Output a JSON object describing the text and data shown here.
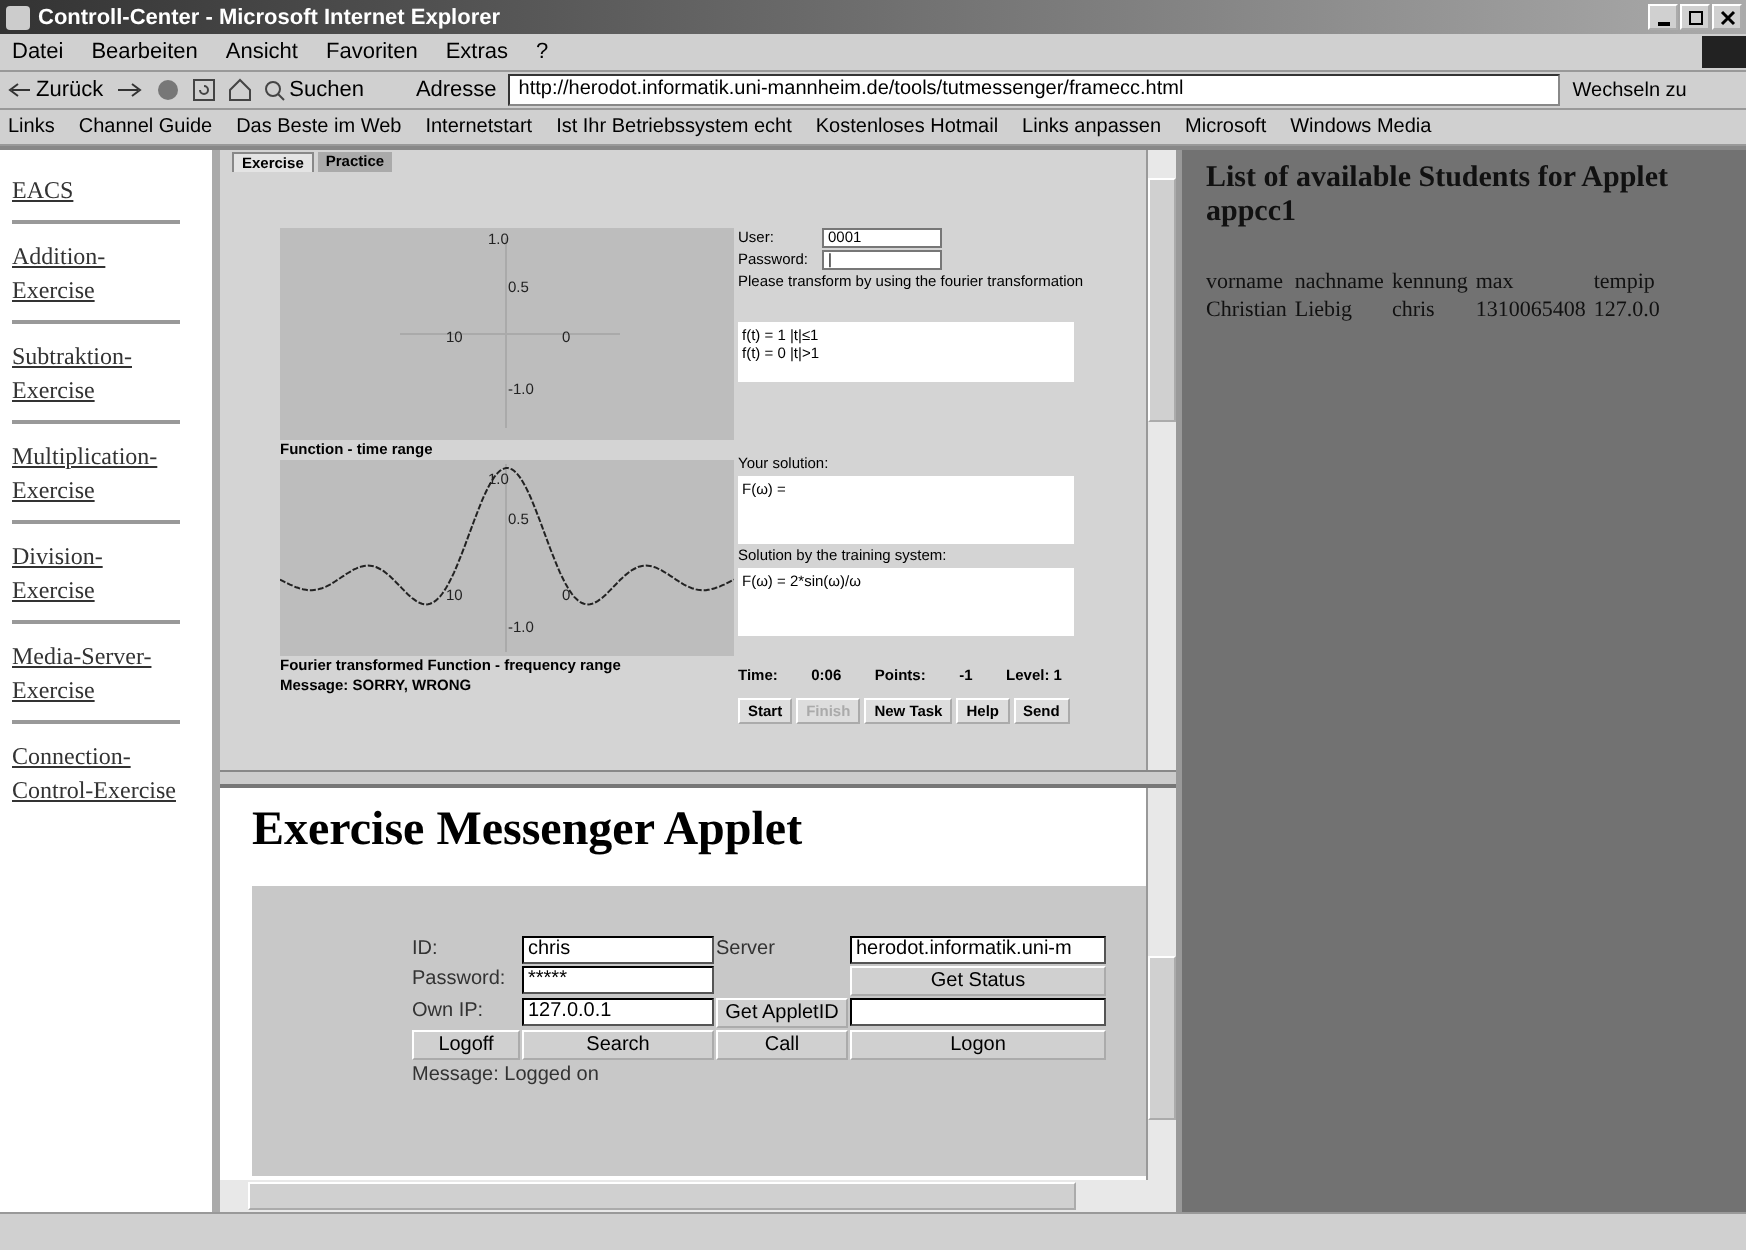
{
  "window": {
    "title": "Controll-Center - Microsoft Internet Explorer"
  },
  "menu": [
    "Datei",
    "Bearbeiten",
    "Ansicht",
    "Favoriten",
    "Extras",
    "?"
  ],
  "toolbar": {
    "back": "Zurück",
    "search": "Suchen",
    "address_label": "Adresse",
    "address": "http://herodot.informatik.uni-mannheim.de/tools/tutmessenger/framecc.html",
    "go": "Wechseln zu"
  },
  "links": {
    "label": "Links",
    "items": [
      "Channel Guide",
      "Das Beste im Web",
      "Internetstart",
      "Ist Ihr Betriebssystem echt",
      "Kostenloses Hotmail",
      "Links anpassen",
      "Microsoft",
      "Windows Media"
    ]
  },
  "sidebar": {
    "items": [
      "EACS",
      "Addition-Exercise",
      "Subtraktion-Exercise",
      "Multiplication-Exercise",
      "Division-Exercise",
      "Media-Server-Exercise",
      "Connection-Control-Exercise"
    ]
  },
  "applet": {
    "tabs": [
      {
        "label": "Exercise",
        "selected": true
      },
      {
        "label": "Practice",
        "selected": false
      }
    ],
    "time_plot_labels": [
      "1.0",
      "0.5",
      "10",
      "0",
      "-1.0"
    ],
    "freq_plot_labels": [
      "1.0",
      "0.5",
      "10",
      "0",
      "-1.0"
    ],
    "time_caption": "Function - time range",
    "freq_caption": "Fourier transformed Function - frequency range",
    "message": "Message: SORRY, WRONG",
    "user_label": "User:",
    "user": "0001",
    "password_label": "Password:",
    "password": "|",
    "task": "Please transform by using the fourier transformation",
    "task_lines": [
      "f(t) = 1   |t|≤1",
      "f(t) = 0   |t|>1"
    ],
    "your_solution_label": "Your solution:",
    "your_solution": "F(ω) =",
    "system_solution_label": "Solution by the training system:",
    "system_solution": "F(ω) = 2*sin(ω)/ω",
    "stats": [
      {
        "label": "Time:",
        "value": "0:06"
      },
      {
        "label": "Points:",
        "value": "-1"
      },
      {
        "label": "Level: 1"
      }
    ],
    "buttons": [
      {
        "label": "Start",
        "disabled": false
      },
      {
        "label": "Finish",
        "disabled": true
      },
      {
        "label": "New Task",
        "disabled": false
      },
      {
        "label": "Help",
        "disabled": false
      },
      {
        "label": "Send",
        "disabled": false
      }
    ]
  },
  "messenger": {
    "title": "Exercise Messenger Applet",
    "id_label": "ID:",
    "id": "chris",
    "server_label": "Server",
    "server": "herodot.informatik.uni-m",
    "password_label": "Password:",
    "password": "*****",
    "status_button": "Get Status",
    "ip_label": "Own IP:",
    "ip": "127.0.0.1",
    "applet_button": "Get AppletID",
    "buttons": [
      "Logoff",
      "Search",
      "Call",
      "Logon"
    ],
    "message": "Message: Logged on"
  },
  "students": {
    "title": "List of available Students for Applet appcc1",
    "columns": [
      "vorname",
      "nachname",
      "kennung",
      "max",
      "tempip"
    ],
    "rows": [
      [
        "Christian",
        "Liebig",
        "chris",
        "1310065408",
        "127.0.0"
      ]
    ]
  }
}
